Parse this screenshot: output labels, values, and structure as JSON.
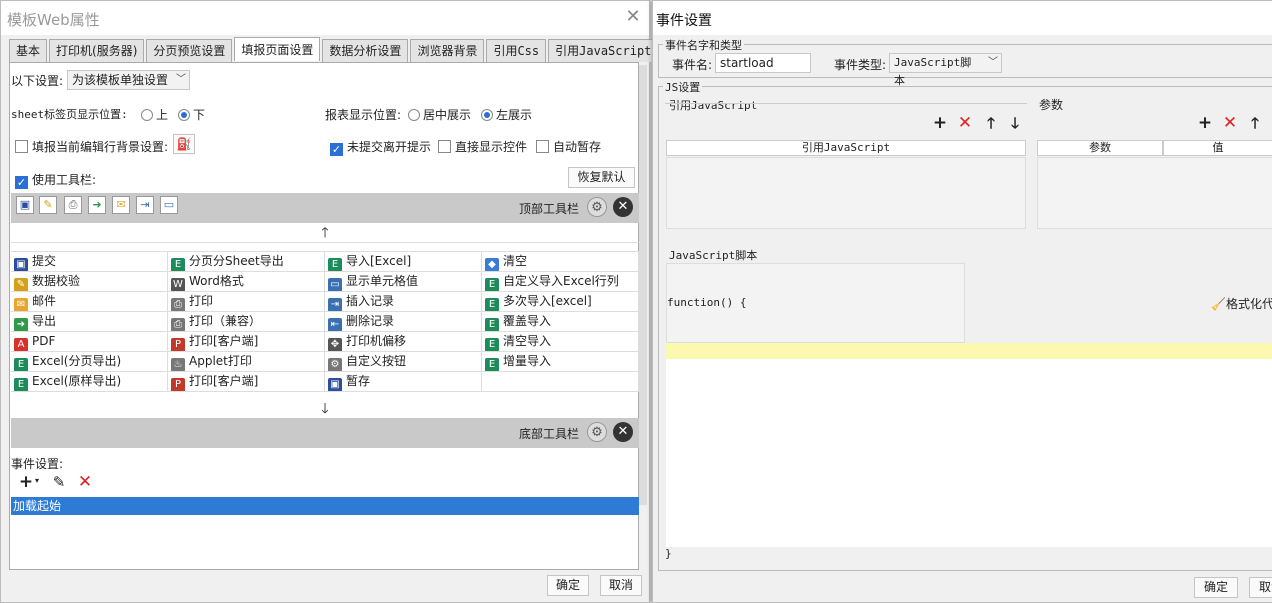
{
  "left_window": {
    "title": "模板Web属性",
    "tabs": [
      "基本",
      "打印机(服务器)",
      "分页预览设置",
      "填报页面设置",
      "数据分析设置",
      "浏览器背景",
      "引用Css",
      "引用JavaScript"
    ],
    "active_tab": "填报页面设置",
    "settings_label": "以下设置:",
    "settings_select": "为该模板单独设置",
    "sheet_label": "sheet标签页显示位置:",
    "sheet_up": "上",
    "sheet_down": "下",
    "report_label": "报表显示位置:",
    "report_center": "居中展示",
    "report_left": "左展示",
    "fill_bg_label": "填报当前编辑行背景设置:",
    "unsubmit_label": "未提交离开提示",
    "direct_label": "直接显示控件",
    "autosave_label": "自动暂存",
    "use_toolbar_label": "使用工具栏:",
    "restore_button": "恢复默认",
    "top_toolbar_label": "顶部工具栏",
    "bottom_toolbar_label": "底部工具栏",
    "grid": [
      [
        {
          "label": "提交",
          "icon": "save-icon",
          "color": "#2b4f9c"
        },
        {
          "label": "分页分Sheet导出",
          "icon": "excel-icon",
          "color": "#1e8b5a"
        },
        {
          "label": "导入[Excel]",
          "icon": "excel-icon",
          "color": "#1e8b5a"
        },
        {
          "label": "清空",
          "icon": "eraser-icon",
          "color": "#3a7bd5"
        }
      ],
      [
        {
          "label": "数据校验",
          "icon": "pencil-icon",
          "color": "#d4a017"
        },
        {
          "label": "Word格式",
          "icon": "word-icon",
          "color": "#555555"
        },
        {
          "label": "显示单元格值",
          "icon": "cell-icon",
          "color": "#3a6fb0"
        },
        {
          "label": "自定义导入Excel行列",
          "icon": "excel-icon",
          "color": "#1e8b5a"
        }
      ],
      [
        {
          "label": "邮件",
          "icon": "mail-icon",
          "color": "#e8a530"
        },
        {
          "label": "打印",
          "icon": "print-icon",
          "color": "#777777"
        },
        {
          "label": "插入记录",
          "icon": "insert-row-icon",
          "color": "#3a6fb0"
        },
        {
          "label": "多次导入[excel]",
          "icon": "excel-icon",
          "color": "#1e8b5a"
        }
      ],
      [
        {
          "label": "导出",
          "icon": "export-icon",
          "color": "#2e9a4a"
        },
        {
          "label": "打印（兼容）",
          "icon": "print-icon",
          "color": "#777777"
        },
        {
          "label": "删除记录",
          "icon": "delete-row-icon",
          "color": "#3a6fb0"
        },
        {
          "label": "覆盖导入",
          "icon": "excel-icon",
          "color": "#1e8b5a"
        }
      ],
      [
        {
          "label": "PDF",
          "icon": "pdf-icon",
          "color": "#d9302c"
        },
        {
          "label": "打印[客户端]",
          "icon": "pdf-print-icon",
          "color": "#c0392b"
        },
        {
          "label": "打印机偏移",
          "icon": "move-icon",
          "color": "#555555"
        },
        {
          "label": "清空导入",
          "icon": "excel-icon",
          "color": "#1e8b5a"
        }
      ],
      [
        {
          "label": "Excel(分页导出)",
          "icon": "excel-icon",
          "color": "#1e8b5a"
        },
        {
          "label": "Applet打印",
          "icon": "applet-icon",
          "color": "#777777"
        },
        {
          "label": "自定义按钮",
          "icon": "gear-icon",
          "color": "#777777"
        },
        {
          "label": "增量导入",
          "icon": "excel-icon",
          "color": "#1e8b5a"
        }
      ],
      [
        {
          "label": "Excel(原样导出)",
          "icon": "excel-icon",
          "color": "#1e8b5a"
        },
        {
          "label": "打印[客户端]",
          "icon": "pdf-print-icon",
          "color": "#c0392b"
        },
        {
          "label": "暂存",
          "icon": "save-icon",
          "color": "#2b4f9c"
        },
        {
          "label": "",
          "icon": "",
          "color": ""
        }
      ]
    ],
    "event_label": "事件设置:",
    "event_item": "加载起始",
    "ok_button": "确定",
    "cancel_button": "取消"
  },
  "right_window": {
    "title": "事件设置",
    "group_name_type": "事件名字和类型",
    "event_name_label": "事件名:",
    "event_name_value": "startload",
    "event_type_label": "事件类型:",
    "event_type_value": "JavaScript脚本",
    "js_settings": "JS设置",
    "ref_js_label": "引用JavaScript",
    "params_label": "参数",
    "ref_js_col": "引用JavaScript",
    "param_col": "参数",
    "value_col": "值",
    "js_script_label": "JavaScript脚本",
    "code_open": "function() {",
    "code_close": "}",
    "format_button": "格式化代",
    "ok_button": "确定",
    "cancel_button": "取消"
  }
}
